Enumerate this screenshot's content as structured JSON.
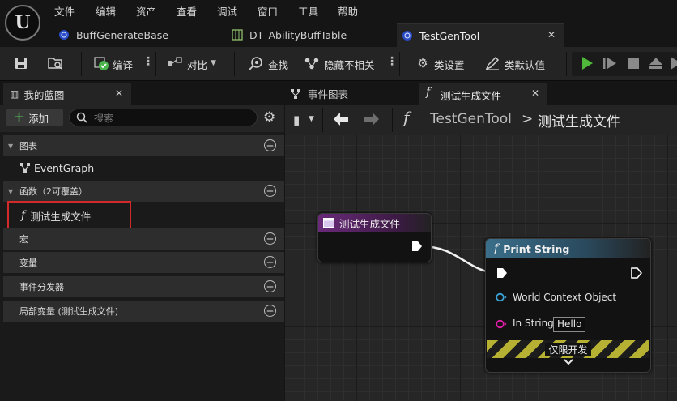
{
  "menu": [
    "文件",
    "编辑",
    "资产",
    "查看",
    "调试",
    "窗口",
    "工具",
    "帮助"
  ],
  "doc_tabs": [
    {
      "label": "BuffGenerateBase"
    },
    {
      "label": "DT_AbilityBuffTable"
    },
    {
      "label": "TestGenTool"
    }
  ],
  "toolbar": {
    "compile": "编译",
    "diff": "对比",
    "find": "查找",
    "hide_unrelated": "隐藏不相关",
    "class_settings": "类设置",
    "class_defaults": "类默认值"
  },
  "my_blueprint": {
    "tab": "我的蓝图",
    "add": "添加",
    "search_placeholder": "搜索",
    "sections": {
      "graphs": "图表",
      "event_graph": "EventGraph",
      "functions": "函数（2可覆盖）",
      "function_item": "测试生成文件",
      "macros": "宏",
      "variables": "变量",
      "dispatchers": "事件分发器",
      "locals": "局部变量 (测试生成文件)"
    }
  },
  "graph_tabs": {
    "event_graph": "事件图表",
    "function": "测试生成文件"
  },
  "breadcrumb": {
    "root": "TestGenTool",
    "sep": ">",
    "current": "测试生成文件"
  },
  "nodes": {
    "entry_title": "测试生成文件",
    "print_title": "Print String",
    "pin_world": "World Context Object",
    "pin_instring": "In String",
    "instring_value": "Hello",
    "dev_only": "仅限开发"
  },
  "colors": {
    "highlight_box": "#d12a2a",
    "compile_ok": "#49b54a",
    "play": "#4fb83a",
    "entry_header": "#6a2a7a",
    "print_header": "#3a6e8a",
    "world_pin": "#3aa4d6",
    "string_pin": "#e21ea8"
  }
}
